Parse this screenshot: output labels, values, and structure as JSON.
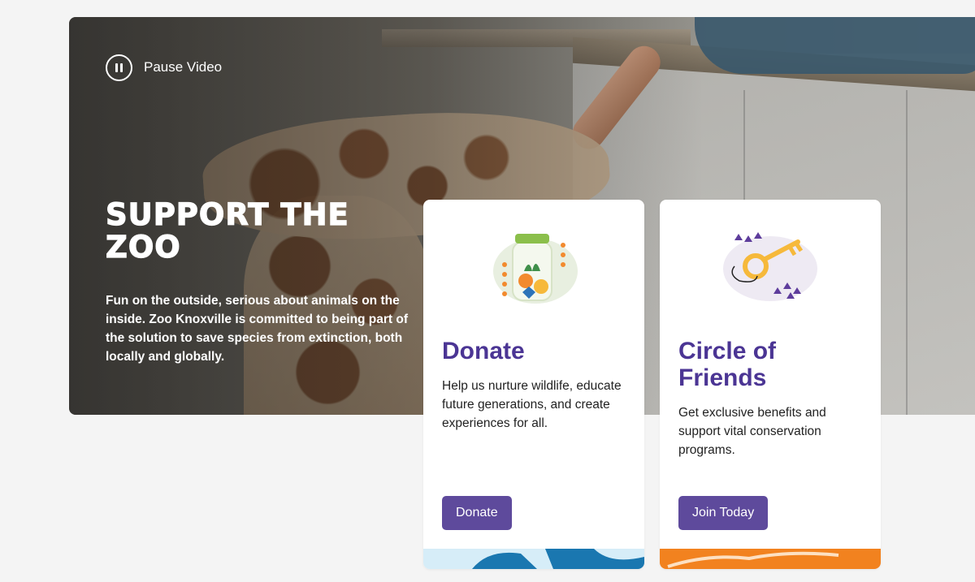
{
  "hero": {
    "pause_label": "Pause Video",
    "title": "SUPPORT THE ZOO",
    "description": "Fun on the outside, serious about animals on the inside. Zoo Knoxville is committed to being part of the solution to save species from extinction, both locally and globally."
  },
  "cards": [
    {
      "icon": "donation-jar-icon",
      "title": "Donate",
      "text": "Help us nurture wildlife, educate future generations, and create experiences for all.",
      "button": "Donate"
    },
    {
      "icon": "key-icon",
      "title": "Circle of Friends",
      "text": "Get exclusive benefits and support vital conservation programs.",
      "button": "Join Today"
    }
  ],
  "colors": {
    "accent": "#4b3594",
    "button": "#5e4a9c",
    "strip_blue": "#1a77b0",
    "strip_orange": "#f2821f"
  }
}
